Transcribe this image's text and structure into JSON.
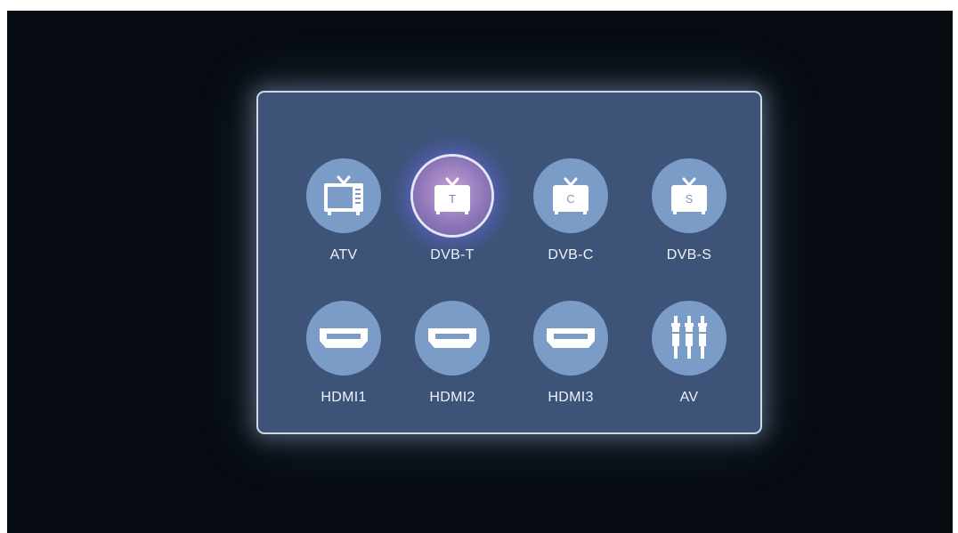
{
  "sources": [
    {
      "id": "atv",
      "label": "ATV",
      "icon": "tv-icon"
    },
    {
      "id": "dvb-t",
      "label": "DVB-T",
      "icon": "tv-letter-icon",
      "letter": "T",
      "focused": true
    },
    {
      "id": "dvb-c",
      "label": "DVB-C",
      "icon": "tv-letter-icon",
      "letter": "C"
    },
    {
      "id": "dvb-s",
      "label": "DVB-S",
      "icon": "tv-letter-icon",
      "letter": "S"
    },
    {
      "id": "hdmi1",
      "label": "HDMI1",
      "icon": "hdmi-port-icon"
    },
    {
      "id": "hdmi2",
      "label": "HDMI2",
      "icon": "hdmi-port-icon"
    },
    {
      "id": "hdmi3",
      "label": "HDMI3",
      "icon": "hdmi-port-icon"
    },
    {
      "id": "av",
      "label": "AV",
      "icon": "rca-connector-icon"
    }
  ],
  "colors": {
    "background": "#060c11",
    "panel": "#3d5478",
    "icon_circle": "#7a9cc6",
    "focused_circle": "#8a74b6",
    "label_text": "#eef2f8"
  }
}
